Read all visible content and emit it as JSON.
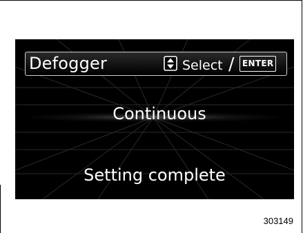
{
  "screen": {
    "title": "Defogger",
    "select_label": "Select",
    "separator": "/",
    "enter_key_label": "ENTER",
    "selected_value": "Continuous",
    "status_message": "Setting complete",
    "icon": "up-down-arrows-icon",
    "background_color": "#000000",
    "text_color": "#ffffff"
  },
  "figure_id": "303149"
}
